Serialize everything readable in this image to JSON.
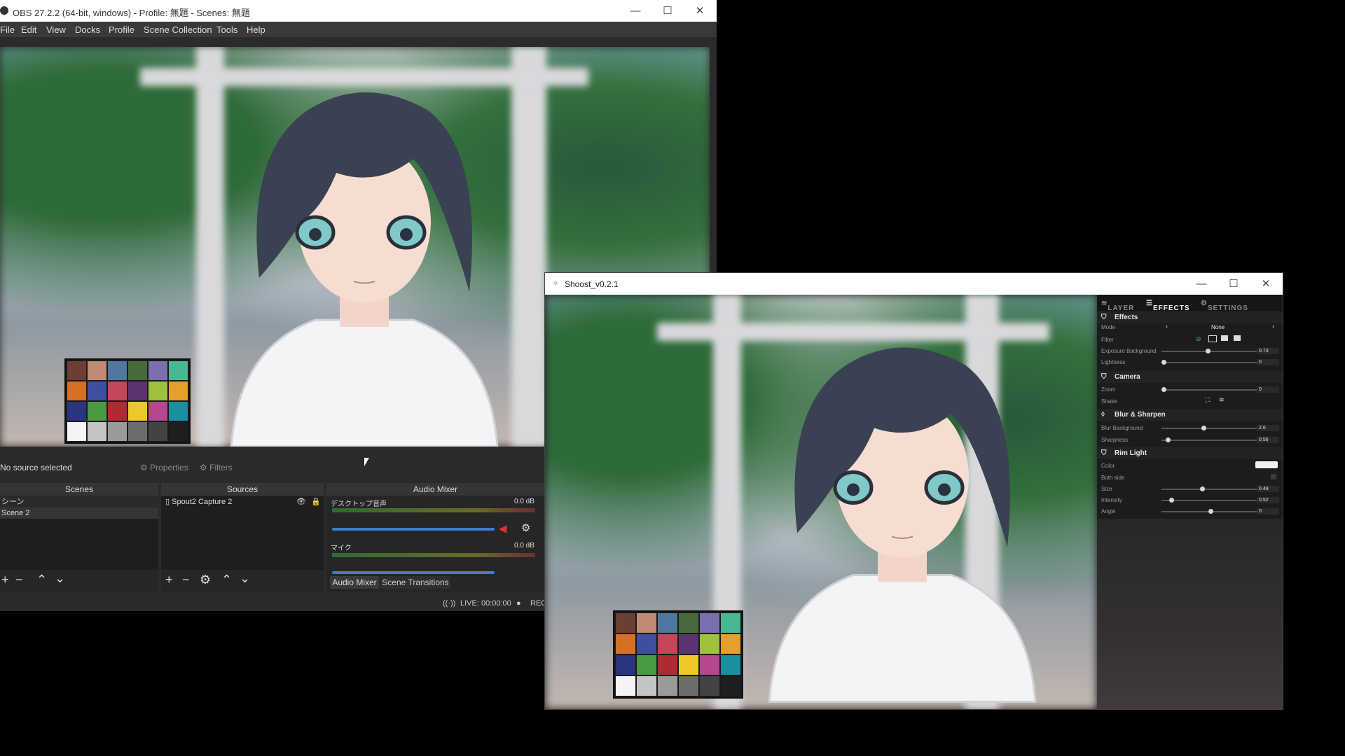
{
  "obs": {
    "window_title": "OBS 27.2.2 (64-bit, windows) - Profile: 無題 - Scenes: 無題",
    "menu": [
      "File",
      "Edit",
      "View",
      "Docks",
      "Profile",
      "Scene Collection",
      "Tools",
      "Help"
    ],
    "status": {
      "no_source": "No source selected",
      "properties": "Properties",
      "filters": "Filters"
    },
    "scenes": {
      "title": "Scenes",
      "items": [
        "シーン",
        "Scene 2"
      ]
    },
    "sources": {
      "title": "Sources",
      "items": [
        "Spout2 Capture 2"
      ]
    },
    "audio_mixer": {
      "title": "Audio Mixer",
      "tracks": [
        {
          "name": "デスクトップ音声",
          "level": "0.0 dB"
        },
        {
          "name": "マイク",
          "level": "0.0 dB"
        }
      ],
      "tab_mixer": "Audio Mixer",
      "tab_transitions": "Scene Transitions"
    },
    "footer": {
      "live": "LIVE: 00:00:00",
      "rec": "REC"
    }
  },
  "shoost": {
    "window_title": "Shoost_v0.2.1",
    "tabs": [
      "LAYER",
      "EFFECTS",
      "SETTINGS"
    ],
    "sections": {
      "effects": "Effects",
      "camera": "Camera",
      "blur": "Blur & Sharpen",
      "rim": "Rim Light"
    },
    "effects": {
      "mode_label": "Mode",
      "mode_value": "None",
      "filter_label": "Filter",
      "exposure_label": "Exposure Background",
      "exposure_value": "0.73",
      "lightness_label": "Lightness",
      "lightness_value": "0"
    },
    "camera": {
      "zoom_label": "Zoom",
      "zoom_value": "0",
      "shake_label": "Shake"
    },
    "blur": {
      "bg_label": "Blur Background",
      "bg_value": "2.6",
      "sharp_label": "Sharpness",
      "sharp_value": "0.56"
    },
    "rim": {
      "color_label": "Color",
      "both_label": "Both side",
      "size_label": "Size",
      "size_value": "0.49",
      "intensity_label": "Intensity",
      "intensity_value": "0.52",
      "angle_label": "Angle",
      "angle_value": "0"
    }
  },
  "colors": {
    "checker": [
      "#6b3f36",
      "#c08a76",
      "#5077a0",
      "#486a3a",
      "#7c6fb0",
      "#49b890",
      "#d67025",
      "#3f4fa0",
      "#c3465a",
      "#5a3470",
      "#9ec13f",
      "#e59f2a",
      "#2a3480",
      "#4a9a45",
      "#b02a32",
      "#ecc82a",
      "#b5468f",
      "#1a8fa0",
      "#f4f4f4",
      "#c4c4c4",
      "#9a9a9a",
      "#6c6c6c",
      "#434343",
      "#1e1e1e"
    ]
  }
}
